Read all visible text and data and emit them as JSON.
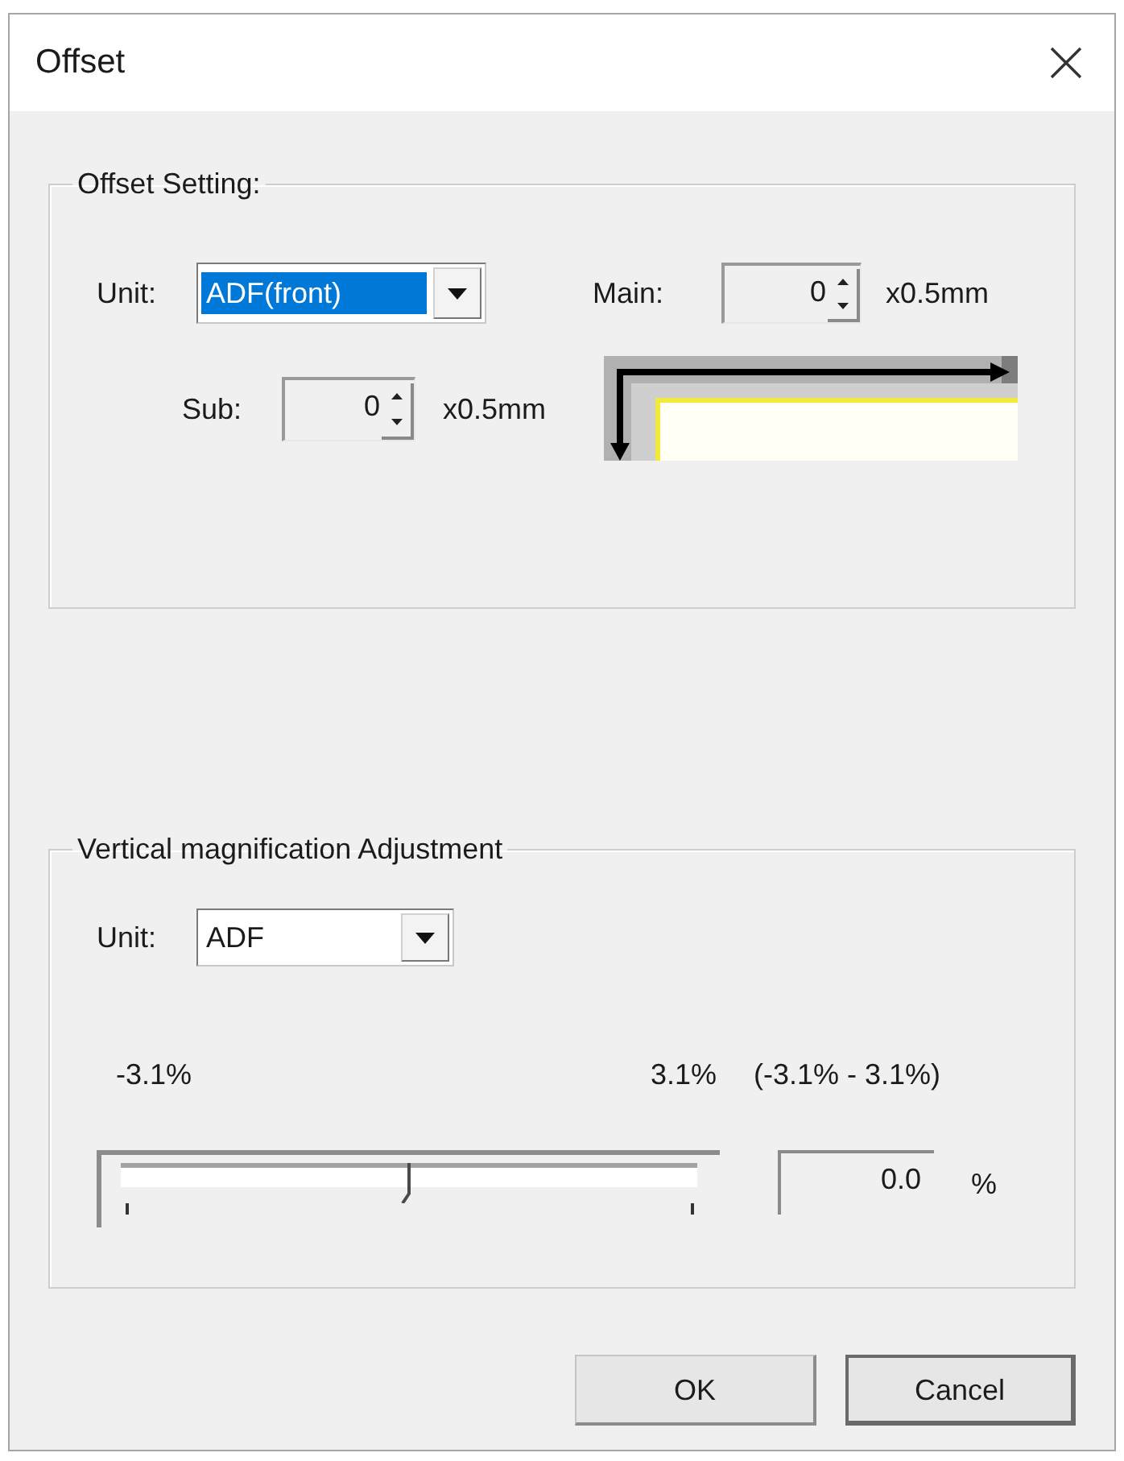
{
  "window": {
    "title": "Offset"
  },
  "offset_setting": {
    "title": "Offset Setting:",
    "unit": {
      "label": "Unit:",
      "value": "ADF(front)",
      "focused": true
    },
    "main": {
      "label": "Main:",
      "value": "0",
      "unit": "x0.5mm"
    },
    "sub": {
      "label": "Sub:",
      "value": "0",
      "unit": "x0.5mm"
    }
  },
  "vertical_magnification": {
    "title": "Vertical magnification Adjustment",
    "unit": {
      "label": "Unit:",
      "value": "ADF",
      "focused": false
    },
    "min_label": "-3.1%",
    "max_label": "3.1%",
    "range": "(-3.1% - 3.1%)",
    "slider": {
      "level": 0.5
    },
    "value": "0.0",
    "value_unit": "%"
  },
  "buttons": [
    {
      "label": "OK",
      "default": false
    },
    {
      "label": "Cancel",
      "default": true
    }
  ]
}
